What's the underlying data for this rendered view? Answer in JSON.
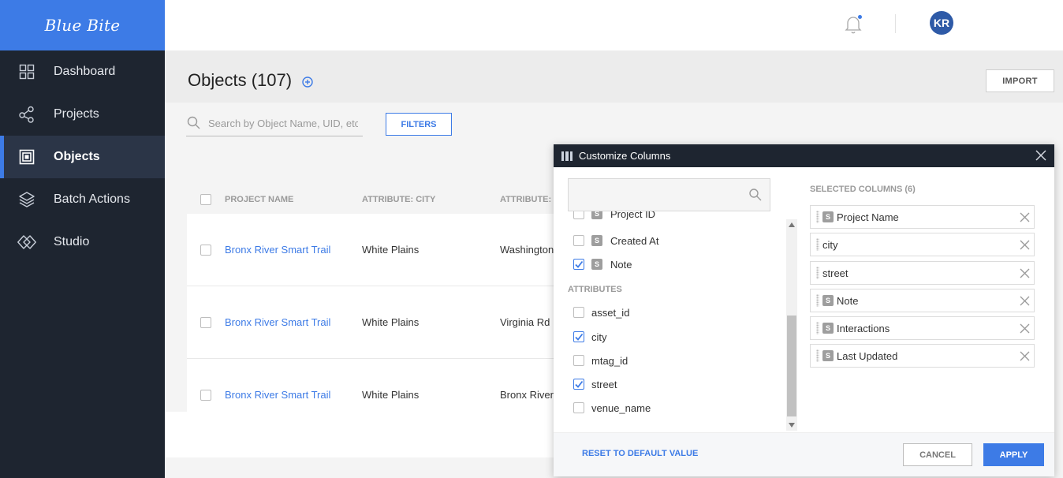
{
  "brand": {
    "name": "Blue Bite"
  },
  "sidebar": {
    "items": [
      {
        "label": "Dashboard",
        "icon": "grid-icon"
      },
      {
        "label": "Projects",
        "icon": "share-nodes-icon"
      },
      {
        "label": "Objects",
        "icon": "tag-square-icon",
        "active": true
      },
      {
        "label": "Batch Actions",
        "icon": "layers-icon"
      },
      {
        "label": "Studio",
        "icon": "diamond-link-icon"
      }
    ]
  },
  "topbar": {
    "avatar_initials": "KR"
  },
  "page": {
    "title": "Objects (107)",
    "import_label": "IMPORT",
    "search_placeholder": "Search by Object Name, UID, etc.",
    "filters_label": "FILTERS"
  },
  "table": {
    "headers": [
      "PROJECT NAME",
      "ATTRIBUTE: CITY",
      "ATTRIBUTE: S"
    ],
    "rows": [
      {
        "project": "Bronx River Smart Trail",
        "city": "White Plains",
        "street": "Washington"
      },
      {
        "project": "Bronx River Smart Trail",
        "city": "White Plains",
        "street": "Virginia Rd"
      },
      {
        "project": "Bronx River Smart Trail",
        "city": "White Plains",
        "street": "Bronx River"
      }
    ]
  },
  "modal": {
    "title": "Customize Columns",
    "available": {
      "standard": [
        {
          "label": "Project ID",
          "checked": false
        },
        {
          "label": "Created At",
          "checked": false
        },
        {
          "label": "Note",
          "checked": true
        }
      ],
      "attributes_heading": "ATTRIBUTES",
      "attributes": [
        {
          "label": "asset_id",
          "checked": false
        },
        {
          "label": "city",
          "checked": true
        },
        {
          "label": "mtag_id",
          "checked": false
        },
        {
          "label": "street",
          "checked": true
        },
        {
          "label": "venue_name",
          "checked": false
        }
      ],
      "badge": "S"
    },
    "selected_heading": "SELECTED COLUMNS (6)",
    "selected": [
      {
        "label": "Project Name",
        "badge": true
      },
      {
        "label": "city",
        "badge": false
      },
      {
        "label": "street",
        "badge": false
      },
      {
        "label": "Note",
        "badge": true
      },
      {
        "label": "Interactions",
        "badge": true
      },
      {
        "label": "Last Updated",
        "badge": true
      }
    ],
    "reset_label": "RESET TO DEFAULT VALUE",
    "cancel_label": "CANCEL",
    "apply_label": "APPLY"
  }
}
